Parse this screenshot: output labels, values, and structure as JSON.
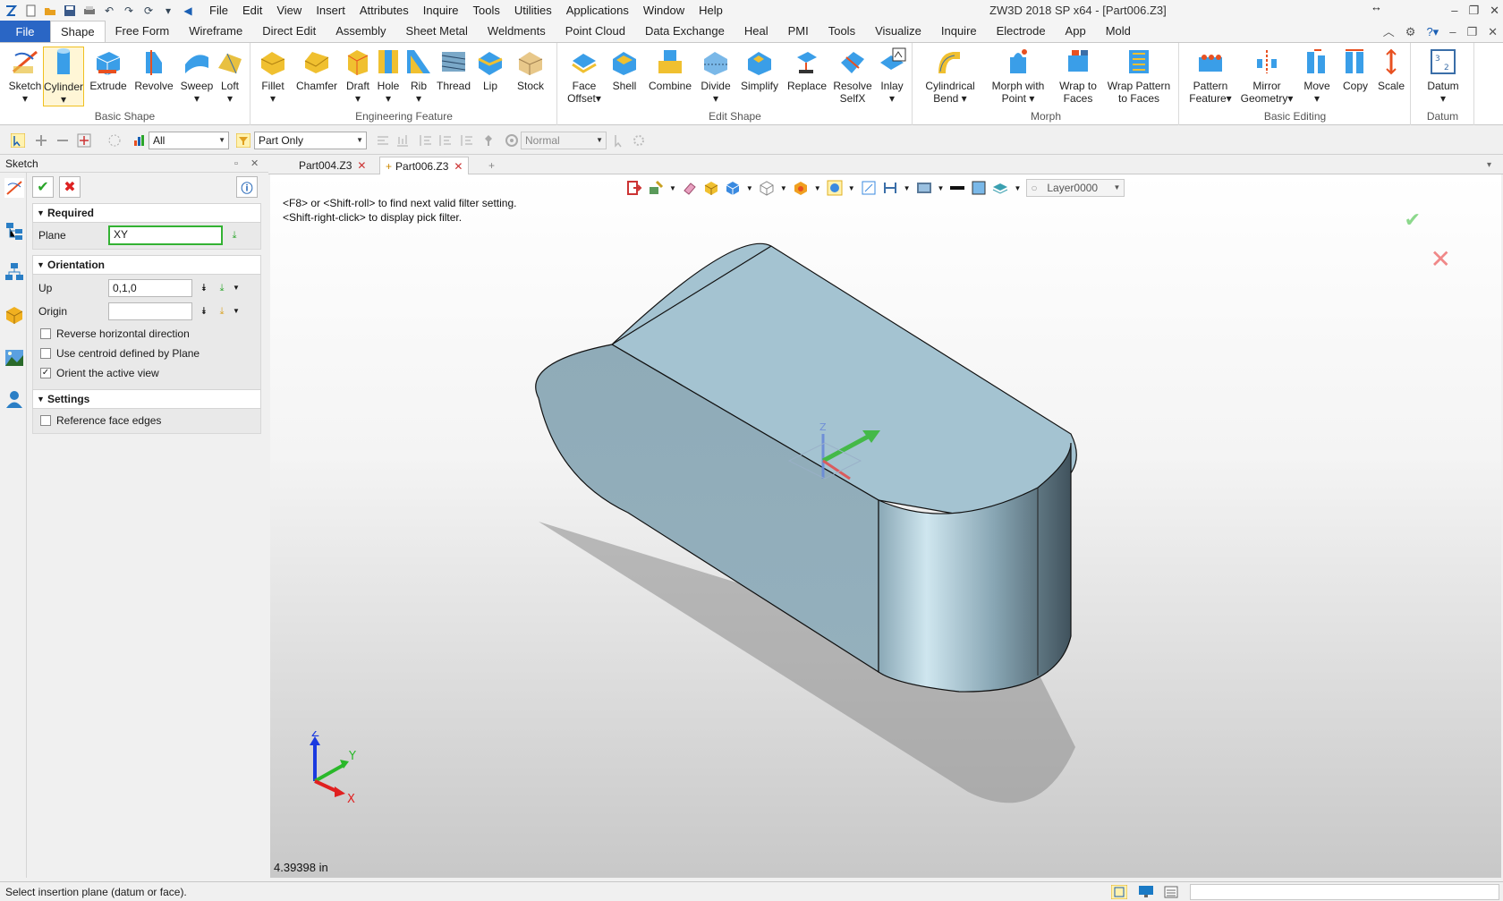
{
  "app": {
    "window_title": "ZW3D 2018 SP x64 - [Part006.Z3]"
  },
  "menu": [
    "File",
    "Edit",
    "View",
    "Insert",
    "Attributes",
    "Inquire",
    "Tools",
    "Utilities",
    "Applications",
    "Window",
    "Help"
  ],
  "ribbon_tabs": [
    "File",
    "Shape",
    "Free Form",
    "Wireframe",
    "Direct Edit",
    "Assembly",
    "Sheet Metal",
    "Weldments",
    "Point Cloud",
    "Data Exchange",
    "Heal",
    "PMI",
    "Tools",
    "Visualize",
    "Inquire",
    "Electrode",
    "App",
    "Mold"
  ],
  "active_tab": "Shape",
  "ribbon": {
    "basic_shape": {
      "label": "Basic Shape",
      "buttons": [
        "Sketch",
        "Cylinder",
        "Extrude",
        "Revolve",
        "Sweep",
        "Loft"
      ]
    },
    "engineering_feature": {
      "label": "Engineering Feature",
      "buttons": [
        "Fillet",
        "Chamfer",
        "Draft",
        "Hole",
        "Rib",
        "Thread",
        "Lip",
        "Stock"
      ]
    },
    "edit_shape": {
      "label": "Edit Shape",
      "buttons": [
        "Face",
        "Offset",
        "Shell",
        "Combine",
        "Divide",
        "Simplify",
        "Replace",
        "Resolve",
        "SelfX",
        "Inlay"
      ]
    },
    "morph": {
      "label": "Morph",
      "buttons": [
        "Cylindrical",
        "Bend",
        "Morph with",
        "Point",
        "Wrap to",
        "Faces",
        "Wrap Pattern",
        "to Faces"
      ]
    },
    "basic_editing": {
      "label": "Basic Editing",
      "buttons": [
        "Pattern",
        "Feature",
        "Mirror",
        "Geometry",
        "Move",
        "Copy",
        "Scale"
      ]
    },
    "datum": {
      "label": "Datum",
      "buttons": [
        "Datum"
      ]
    }
  },
  "toolbar2": {
    "filter_value": "All",
    "scope_value": "Part Only",
    "mode_value": "Normal"
  },
  "panel": {
    "title": "Sketch",
    "required_label": "Required",
    "plane_label": "Plane",
    "plane_value": "XY",
    "orientation_label": "Orientation",
    "up_label": "Up",
    "up_value": "0,1,0",
    "origin_label": "Origin",
    "origin_value": "",
    "reverse_label": "Reverse horizontal direction",
    "reverse_checked": false,
    "centroid_label": "Use centroid defined by Plane",
    "centroid_checked": false,
    "orient_label": "Orient the active view",
    "orient_checked": true,
    "settings_label": "Settings",
    "ref_edges_label": "Reference face edges",
    "ref_edges_checked": false
  },
  "doc_tabs": [
    {
      "label": "Part004.Z3",
      "active": false
    },
    {
      "label": "Part006.Z3",
      "active": true
    }
  ],
  "viewport": {
    "hint_line1": "<F8> or <Shift-roll> to find next valid filter setting.",
    "hint_line2": "<Shift-right-click> to display pick filter.",
    "layer": "Layer0000",
    "distance": "4.39398 in",
    "axis_x": "X",
    "axis_y": "Y",
    "axis_z": "Z",
    "triad_z": "Z"
  },
  "status": {
    "text": "Select insertion plane (datum or face)."
  },
  "colors": {
    "accent": "#2a66c5",
    "model_top": "#a4c3d1",
    "model_side": "#8aa6b3",
    "ok_green": "#2aa52a",
    "cancel_red": "#d22222"
  }
}
